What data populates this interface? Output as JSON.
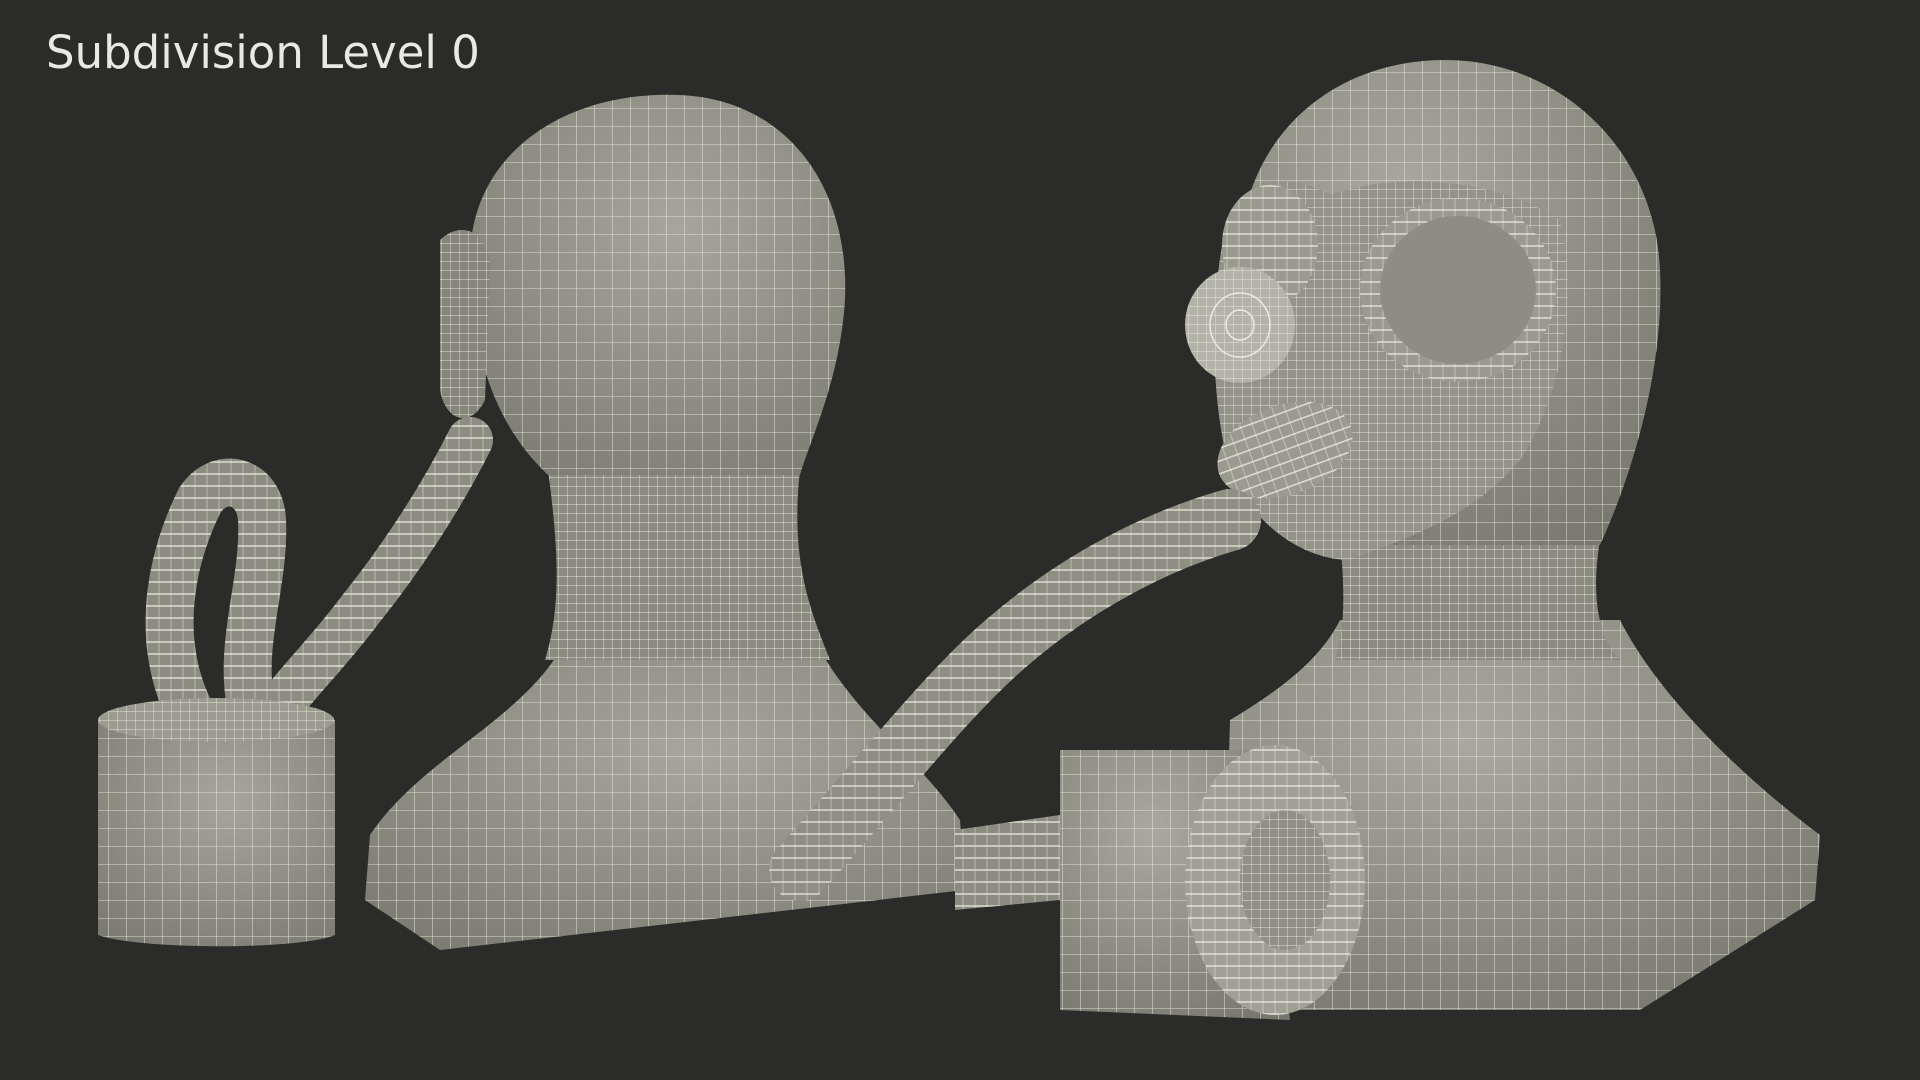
{
  "overlay": {
    "label": "Subdivision Level 0"
  },
  "colors": {
    "background": "#2b2b29",
    "mesh_fill": "#8f8f84",
    "mesh_fill_light": "#a3a398",
    "wire": "#ecebe0",
    "label": "#e9e9e4"
  },
  "scene": {
    "objects": [
      "gas-mask-head-rear-view",
      "gas-mask-head-front-view"
    ]
  }
}
